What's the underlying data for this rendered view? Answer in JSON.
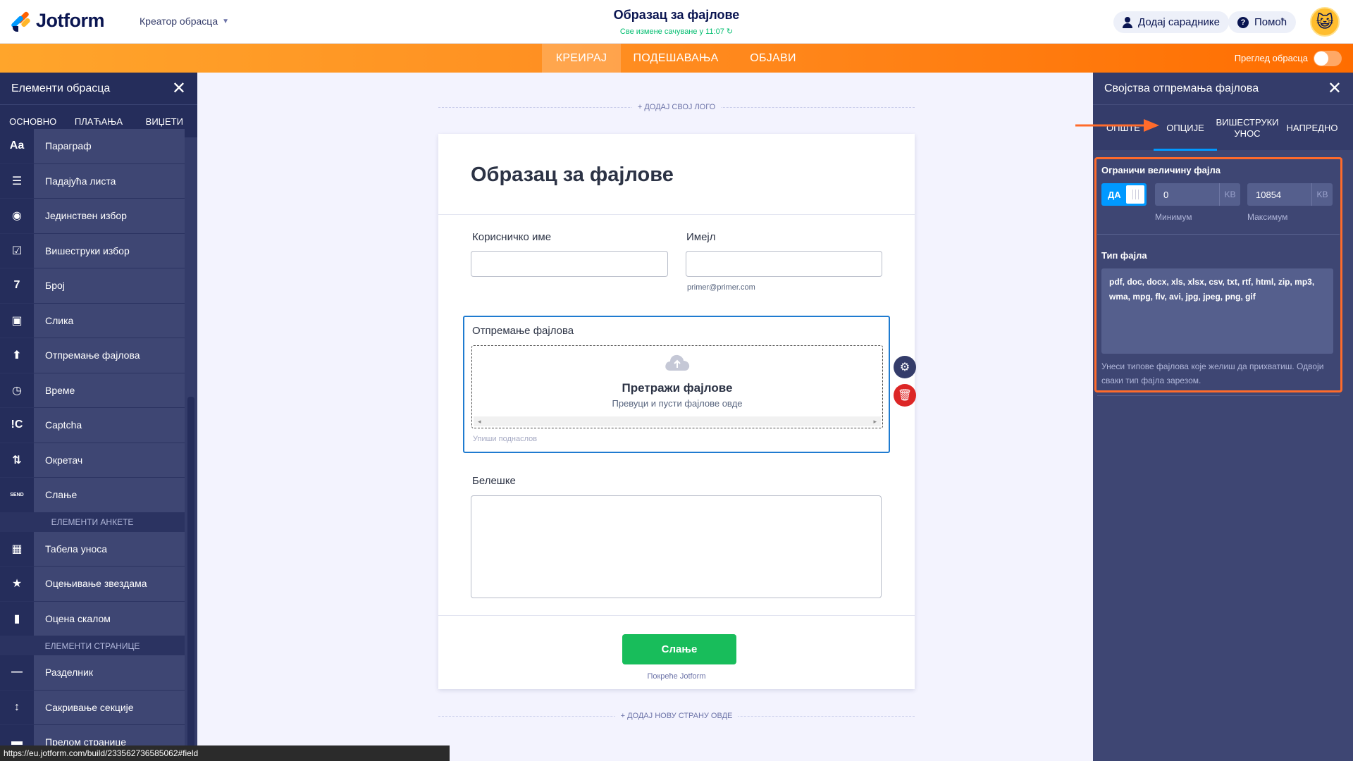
{
  "header": {
    "logo_text": "Jotform",
    "builder_mode": "Креатор обрасца",
    "form_title": "Образац за фајлове",
    "save_status": "Све измене сачуване у 11:07 ↻",
    "add_collaborators": "Додај сараднике",
    "help": "Помоћ",
    "help_glyph": "?"
  },
  "nav": {
    "tabs": [
      "КРЕИРАЈ",
      "ПОДЕШАВАЊА",
      "ОБЈАВИ"
    ],
    "active": "КРЕИРАЈ",
    "preview_label": "Преглед обрасца"
  },
  "left_panel": {
    "title": "Елементи обрасца",
    "tabs": [
      "ОСНОВНО",
      "ПЛАЋАЊА",
      "ВИЏЕТИ"
    ],
    "items": [
      {
        "icon": "paragraph-icon",
        "glyph": "Aa",
        "label": "Параграф"
      },
      {
        "icon": "dropdown-icon",
        "glyph": "☰",
        "label": "Падајућа листа"
      },
      {
        "icon": "radio-icon",
        "glyph": "◉",
        "label": "Јединствен избор"
      },
      {
        "icon": "checkbox-icon",
        "glyph": "☑",
        "label": "Вишеструки избор"
      },
      {
        "icon": "number-icon",
        "glyph": "7",
        "label": "Број"
      },
      {
        "icon": "image-icon",
        "glyph": "▣",
        "label": "Слика"
      },
      {
        "icon": "file-upload-icon",
        "glyph": "⬆",
        "label": "Отпремање фајлова"
      },
      {
        "icon": "clock-icon",
        "glyph": "◷",
        "label": "Време"
      },
      {
        "icon": "captcha-icon",
        "glyph": "!C",
        "label": "Captcha"
      },
      {
        "icon": "spinner-icon",
        "glyph": "⇅",
        "label": "Окретач"
      },
      {
        "icon": "send-icon",
        "glyph": "SEND",
        "label": "Слање"
      }
    ],
    "survey_section": "ЕЛЕМЕНТИ АНКЕТЕ",
    "survey_items": [
      {
        "icon": "table-icon",
        "glyph": "▦",
        "label": "Табела уноса"
      },
      {
        "icon": "star-icon",
        "glyph": "★",
        "label": "Оцењивање звездама"
      },
      {
        "icon": "bar-chart-icon",
        "glyph": "▮",
        "label": "Оцена скалом"
      }
    ],
    "page_section": "ЕЛЕМЕНТИ СТРАНИЦЕ",
    "page_items": [
      {
        "icon": "divider-icon",
        "glyph": "—",
        "label": "Разделник"
      },
      {
        "icon": "collapse-icon",
        "glyph": "↕",
        "label": "Сакривање секције"
      },
      {
        "icon": "page-break-icon",
        "glyph": "▬",
        "label": "Прелом странице"
      }
    ]
  },
  "canvas": {
    "add_logo": "+ ДОДАЈ СВОЈ ЛОГО",
    "form_heading": "Образац за фајлове",
    "username_label": "Корисничко име",
    "email_label": "Имејл",
    "email_sublabel": "primer@primer.com",
    "upload_label": "Отпремање фајлова",
    "upload_browse": "Претражи фајлове",
    "upload_drag": "Превуци и пусти фајлове овде",
    "upload_sublabel_hint": "Упиши поднаслов",
    "notes_label": "Белешке",
    "submit": "Слање",
    "powered": "Покреће Jotform",
    "add_page": "+ ДОДАЈ НОВУ СТРАНУ ОВДЕ"
  },
  "right_panel": {
    "title": "Својства отпремања фајлова",
    "tabs": [
      "ОПШТЕ",
      "ОПЦИЈЕ",
      "ВИШЕСТРУКИ УНОС",
      "НАПРЕДНО"
    ],
    "active_tab": "ОПЦИЈЕ",
    "limit_title": "Ограничи величину фајла",
    "toggle_label": "ДА",
    "min_value": "0",
    "max_value": "10854",
    "unit": "KB",
    "min_caption": "Минимум",
    "max_caption": "Максимум",
    "file_type_title": "Тип фајла",
    "file_types": "pdf, doc, docx, xls, xlsx, csv, txt, rtf, html, zip, mp3, wma, mpg, flv, avi, jpg, jpeg, png, gif",
    "help_text": "Унеси типове фајлова које желиш да прихватиш. Одвоји сваки тип фајла зарезом."
  },
  "colors": {
    "navy": "#0a1551",
    "orange": "#ff6d00",
    "accent_blue": "#0099ff",
    "highlight": "#ff6b2b",
    "submit_green": "#18bd5b"
  },
  "status_bar": {
    "url": "https://eu.jotform.com/build/233562736585062#field"
  }
}
